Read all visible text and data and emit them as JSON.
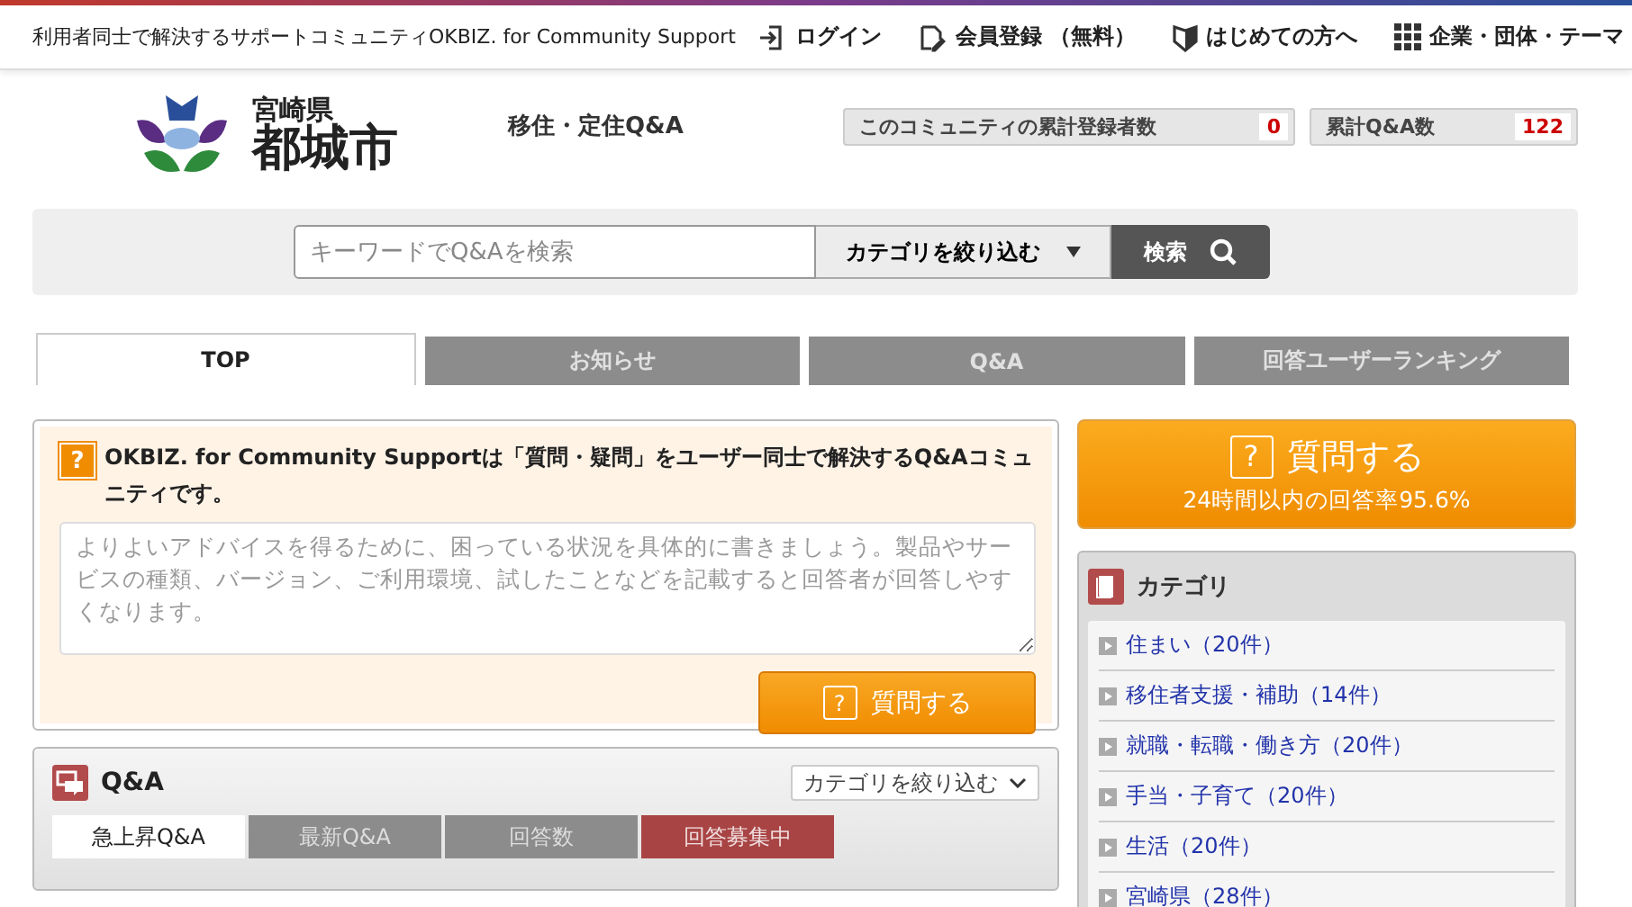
{
  "topbar": {
    "tagline": "利用者同士で解決するサポートコミュニティOKBIZ. for Community Support",
    "links": [
      {
        "kind": "login",
        "label": "ログイン"
      },
      {
        "kind": "register",
        "label": "会員登録 （無料）"
      },
      {
        "kind": "beginner",
        "label": "はじめての方へ"
      },
      {
        "kind": "grid",
        "label": "企業・団体・テーマ"
      }
    ]
  },
  "header": {
    "logo_pref": "宮崎県",
    "logo_city": "都城市",
    "site_title": "移住・定住Q&A",
    "stats": [
      {
        "label": "このコミュニティの累計登録者数",
        "value": "0"
      },
      {
        "label": "累計Q&A数",
        "value": "122"
      }
    ]
  },
  "search": {
    "placeholder": "キーワードでQ&Aを検索",
    "category": "カテゴリを絞り込む",
    "button": "検索"
  },
  "tabs": [
    {
      "label": "TOP",
      "selected": true
    },
    {
      "label": "お知らせ",
      "selected": false
    },
    {
      "label": "Q&A",
      "selected": false
    },
    {
      "label": "回答ユーザーランキング",
      "selected": false
    }
  ],
  "ask_panel": {
    "icon": "?",
    "intro": "OKBIZ. for Community Supportは「質問・疑問」をユーザー同士で解決するQ&Aコミュニティです。",
    "placeholder": "よりよいアドバイスを得るために、困っている状況を具体的に書きましょう。製品やサービスの種類、バージョン、ご利用環境、試したことなどを記載すると回答者が回答しやすくなります。",
    "button_icon": "?",
    "button": "質問する"
  },
  "qa_panel": {
    "title": "Q&A",
    "filter": "カテゴリを絞り込む",
    "tabs": [
      {
        "label": "急上昇Q&A",
        "selected": true,
        "kind": "normal"
      },
      {
        "label": "最新Q&A",
        "selected": false,
        "kind": "normal"
      },
      {
        "label": "回答数",
        "selected": false,
        "kind": "normal"
      },
      {
        "label": "回答募集中",
        "selected": false,
        "kind": "accent"
      }
    ]
  },
  "big_ask": {
    "icon": "?",
    "label": "質問する",
    "sub": "24時間以内の回答率95.6%"
  },
  "categories": {
    "title": "カテゴリ",
    "items": [
      "住まい（20件）",
      "移住者支援・補助（14件）",
      "就職・転職・働き方（20件）",
      "手当・子育て（20件）",
      "生活（20件）",
      "宮崎県（28件）"
    ]
  }
}
